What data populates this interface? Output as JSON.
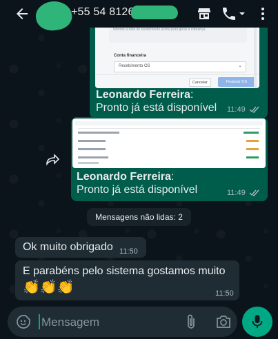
{
  "header": {
    "phone": "+55 54 8126"
  },
  "messages": {
    "first": {
      "sender": "Leonardo Ferreira",
      "text": "Pronto já está disponível",
      "time": "11:49",
      "shot": {
        "info_text": "Informe a data de recebimento acima para gerar a cobrança.",
        "account_label": "Conta financeira",
        "account_value": "Recebimento OS",
        "cancel": "Cancelar",
        "confirm": "Finalizar OS"
      }
    },
    "second": {
      "sender": "Leonardo Ferreira",
      "text": "Pronto já está disponível",
      "time": "11:49"
    },
    "unread_label": "Mensagens não lidas: 2",
    "incoming": [
      {
        "text": "Ok muito obrigado",
        "time": "11:50"
      },
      {
        "text": "E parabéns pelo sistema gostamos muito",
        "emoji": "👏👏👏",
        "time": "11:50"
      }
    ]
  },
  "composer": {
    "placeholder": "Mensagem"
  },
  "colors": {
    "accent": "#00a884",
    "outgoing": "#005c4b",
    "incoming": "#202c33",
    "background": "#0b141a"
  }
}
